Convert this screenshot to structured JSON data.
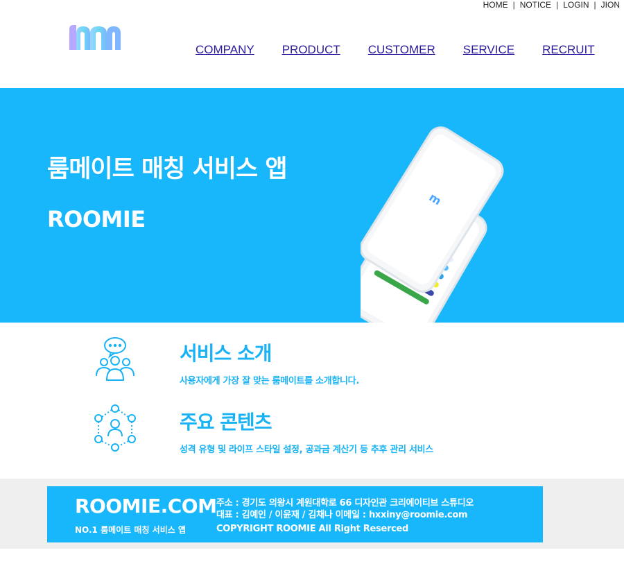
{
  "util_nav": [
    "HOME",
    "NOTICE",
    "LOGIN",
    "JION"
  ],
  "main_nav": [
    "COMPANY",
    "PRODUCT",
    "CUSTOMER",
    "SERVICE",
    "RECRUIT"
  ],
  "hero": {
    "title": "룸메이트 매칭 서비스 앱",
    "subtitle": "ROOMIE"
  },
  "features": [
    {
      "icon": "chat-people-icon",
      "title": "서비스 소개",
      "desc": "사용자에게 가장 잘 맞는 룸메이트를 소개합니다."
    },
    {
      "icon": "network-person-icon",
      "title": "주요 콘텐츠",
      "desc": "성격 유형 및 라이프 스타일 설정, 공과금 계산기 등 추후 관리 서비스"
    }
  ],
  "footer": {
    "brand": "ROOMIE.COM",
    "tagline": "NO.1 룸메이트 매칭 서비스 앱",
    "address": "주소 : 경기도 의왕시 계원대학로 66 디자인관 크리에이티브 스튜디오",
    "representative": "대표 : 김예인 / 이윤재 / 김채나   이메일 : hxxiny@roomie.com",
    "copyright": "COPYRIGHT ROOMIE All Right Reserced"
  },
  "colors": {
    "accent": "#18b6fb",
    "nav_link": "#2a1b9c",
    "footer_band": "#efefef"
  }
}
